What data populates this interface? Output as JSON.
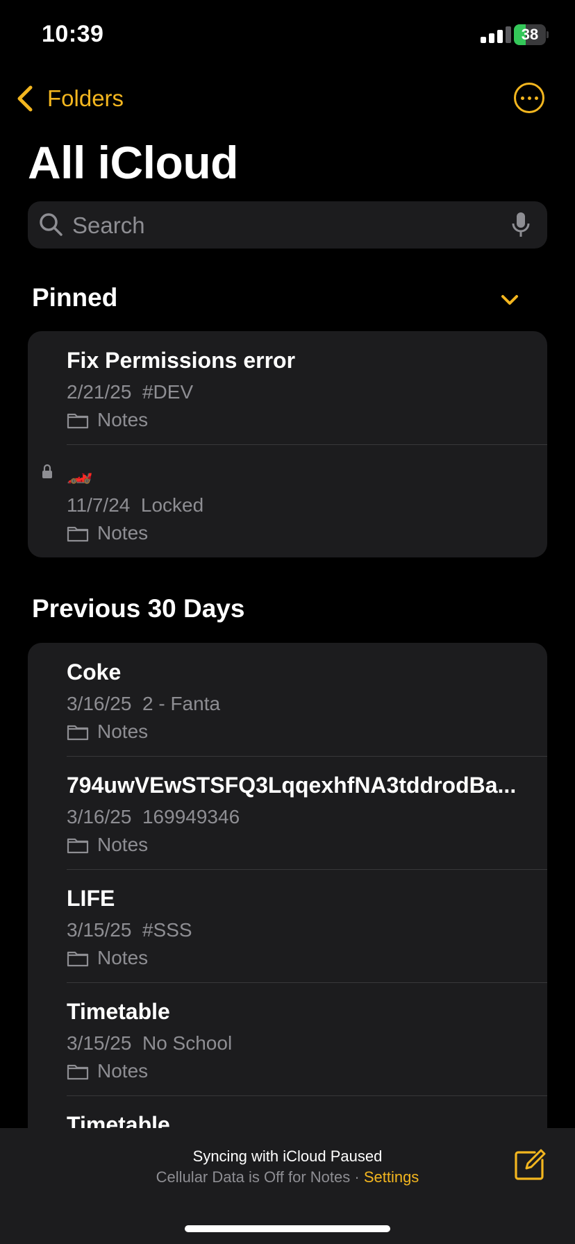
{
  "status_bar": {
    "time": "10:39",
    "battery_level": "38",
    "battery_fraction": 0.38,
    "battery_color": "#34c759",
    "signal_icon": "cellular-signal-icon"
  },
  "nav": {
    "back_label": "Folders",
    "back_icon": "chevron-left-icon",
    "more_icon": "ellipsis-circle-icon",
    "accent_color": "#f3b61f"
  },
  "title": "All iCloud",
  "search": {
    "placeholder": "Search",
    "value": "",
    "icon": "search-icon",
    "mic_icon": "microphone-icon"
  },
  "pinned": {
    "header": "Pinned",
    "collapse_icon": "chevron-down-icon",
    "notes": [
      {
        "title": "Fix Permissions error",
        "date": "2/21/25",
        "preview": "#DEV",
        "folder": "Notes",
        "locked": false
      },
      {
        "title": "🏎️",
        "date": "11/7/24",
        "preview": "Locked",
        "folder": "Notes",
        "locked": true
      }
    ]
  },
  "previous": {
    "header": "Previous 30 Days",
    "notes": [
      {
        "title": "Coke",
        "date": "3/16/25",
        "preview": "2 - Fanta",
        "folder": "Notes"
      },
      {
        "title": "794uwVEwSTSFQ3LqqexhfNA3tddrodBa...",
        "date": "3/16/25",
        "preview": "169949346",
        "folder": "Notes"
      },
      {
        "title": "LIFE",
        "date": "3/15/25",
        "preview": "#SSS",
        "folder": "Notes"
      },
      {
        "title": "Timetable",
        "date": "3/15/25",
        "preview": "No School",
        "folder": "Notes"
      },
      {
        "title": "Timetable"
      }
    ]
  },
  "bottom_bar": {
    "sync_title": "Syncing with iCloud Paused",
    "sync_subtitle": "Cellular Data is Off for Notes · ",
    "settings_link": "Settings",
    "compose_icon": "compose-icon"
  }
}
